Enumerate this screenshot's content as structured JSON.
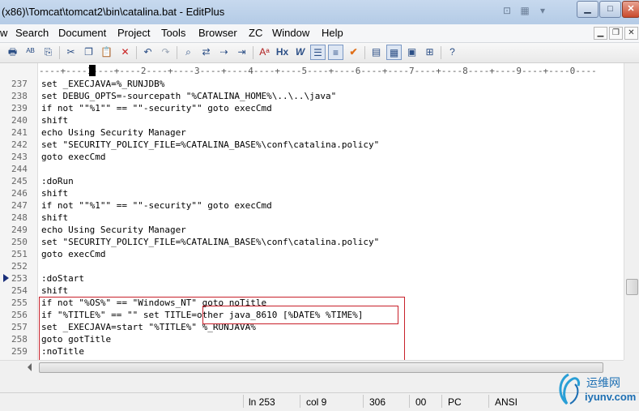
{
  "window": {
    "title": "(x86)\\Tomcat\\tomcat2\\bin\\catalina.bat - EditPlus"
  },
  "titlebar_buttons": {
    "minimize": "▁",
    "maximize": "□",
    "close": "✕"
  },
  "menu": {
    "items": [
      "w",
      "Search",
      "Document",
      "Project",
      "Tools",
      "Browser",
      "ZC",
      "Window",
      "Help"
    ]
  },
  "mdi_buttons": {
    "minimize": "▁",
    "restore": "❐",
    "close": "✕"
  },
  "toolbar": {
    "icons": [
      "printer-icon",
      "spellcheck-icon",
      "preview-icon",
      "cut-icon",
      "copy-icon",
      "paste-icon",
      "delete-icon",
      "undo-icon",
      "redo-icon",
      "find-icon",
      "replace-icon",
      "find-next-icon",
      "goto-line-icon",
      "font-icon",
      "hex-icon",
      "word-wrap-icon",
      "line-numbers-icon",
      "sort-icon",
      "check-icon",
      "ruler-icon",
      "column-icon",
      "browser-icon",
      "toggle-icon",
      "help-icon"
    ],
    "glyphs": [
      "🖶",
      "ᴬᴮ",
      "⎘",
      "✂",
      "❐",
      "📋",
      "✕",
      "↶",
      "↷",
      "⌕",
      "⇄",
      "⇢",
      "⇥",
      "Aᵃ",
      "Hx",
      "W",
      "☰",
      "≡",
      "✔",
      "▤",
      "▦",
      "▣",
      "⊞",
      "?"
    ]
  },
  "ruler": {
    "text": "----+----1----+----2----+----3----+----4----+----5----+----6----+----7----+----8----+----9----+----0----"
  },
  "editor": {
    "bookmark_line": "253",
    "lines": [
      {
        "n": "237",
        "text": "set _EXECJAVA=%_RUNJDB%"
      },
      {
        "n": "238",
        "text": "set DEBUG_OPTS=-sourcepath \"%CATALINA_HOME%\\..\\..\\java\""
      },
      {
        "n": "239",
        "text": "if not \"\"%1\"\" == \"\"-security\"\" goto execCmd"
      },
      {
        "n": "240",
        "text": "shift"
      },
      {
        "n": "241",
        "text": "echo Using Security Manager"
      },
      {
        "n": "242",
        "text": "set \"SECURITY_POLICY_FILE=%CATALINA_BASE%\\conf\\catalina.policy\""
      },
      {
        "n": "243",
        "text": "goto execCmd"
      },
      {
        "n": "244",
        "text": ""
      },
      {
        "n": "245",
        "text": ":doRun"
      },
      {
        "n": "246",
        "text": "shift"
      },
      {
        "n": "247",
        "text": "if not \"\"%1\"\" == \"\"-security\"\" goto execCmd"
      },
      {
        "n": "248",
        "text": "shift"
      },
      {
        "n": "249",
        "text": "echo Using Security Manager"
      },
      {
        "n": "250",
        "text": "set \"SECURITY_POLICY_FILE=%CATALINA_BASE%\\conf\\catalina.policy\""
      },
      {
        "n": "251",
        "text": "goto execCmd"
      },
      {
        "n": "252",
        "text": ""
      },
      {
        "n": "253",
        "text": ":doStart"
      },
      {
        "n": "254",
        "text": "shift"
      },
      {
        "n": "255",
        "text": "if not \"%OS%\" == \"Windows_NT\" goto noTitle"
      },
      {
        "n": "256",
        "text": "if \"%TITLE%\" == \"\" set TITLE=other java_8610 [%DATE% %TIME%]"
      },
      {
        "n": "257",
        "text": "set _EXECJAVA=start \"%TITLE%\" %_RUNJAVA%"
      },
      {
        "n": "258",
        "text": "goto gotTitle"
      },
      {
        "n": "259",
        "text": ":noTitle"
      }
    ]
  },
  "statusbar": {
    "line": "ln 253",
    "col": "col 9",
    "total": "306",
    "code": "00",
    "mode": "PC",
    "encoding": "ANSI"
  },
  "watermark": {
    "cn": "运维网",
    "en": "iyunv.com"
  },
  "colors": {
    "highlight_box": "#c8202a",
    "bookmark": "#1a2f7a",
    "titlebar": "#b4cbe6"
  }
}
